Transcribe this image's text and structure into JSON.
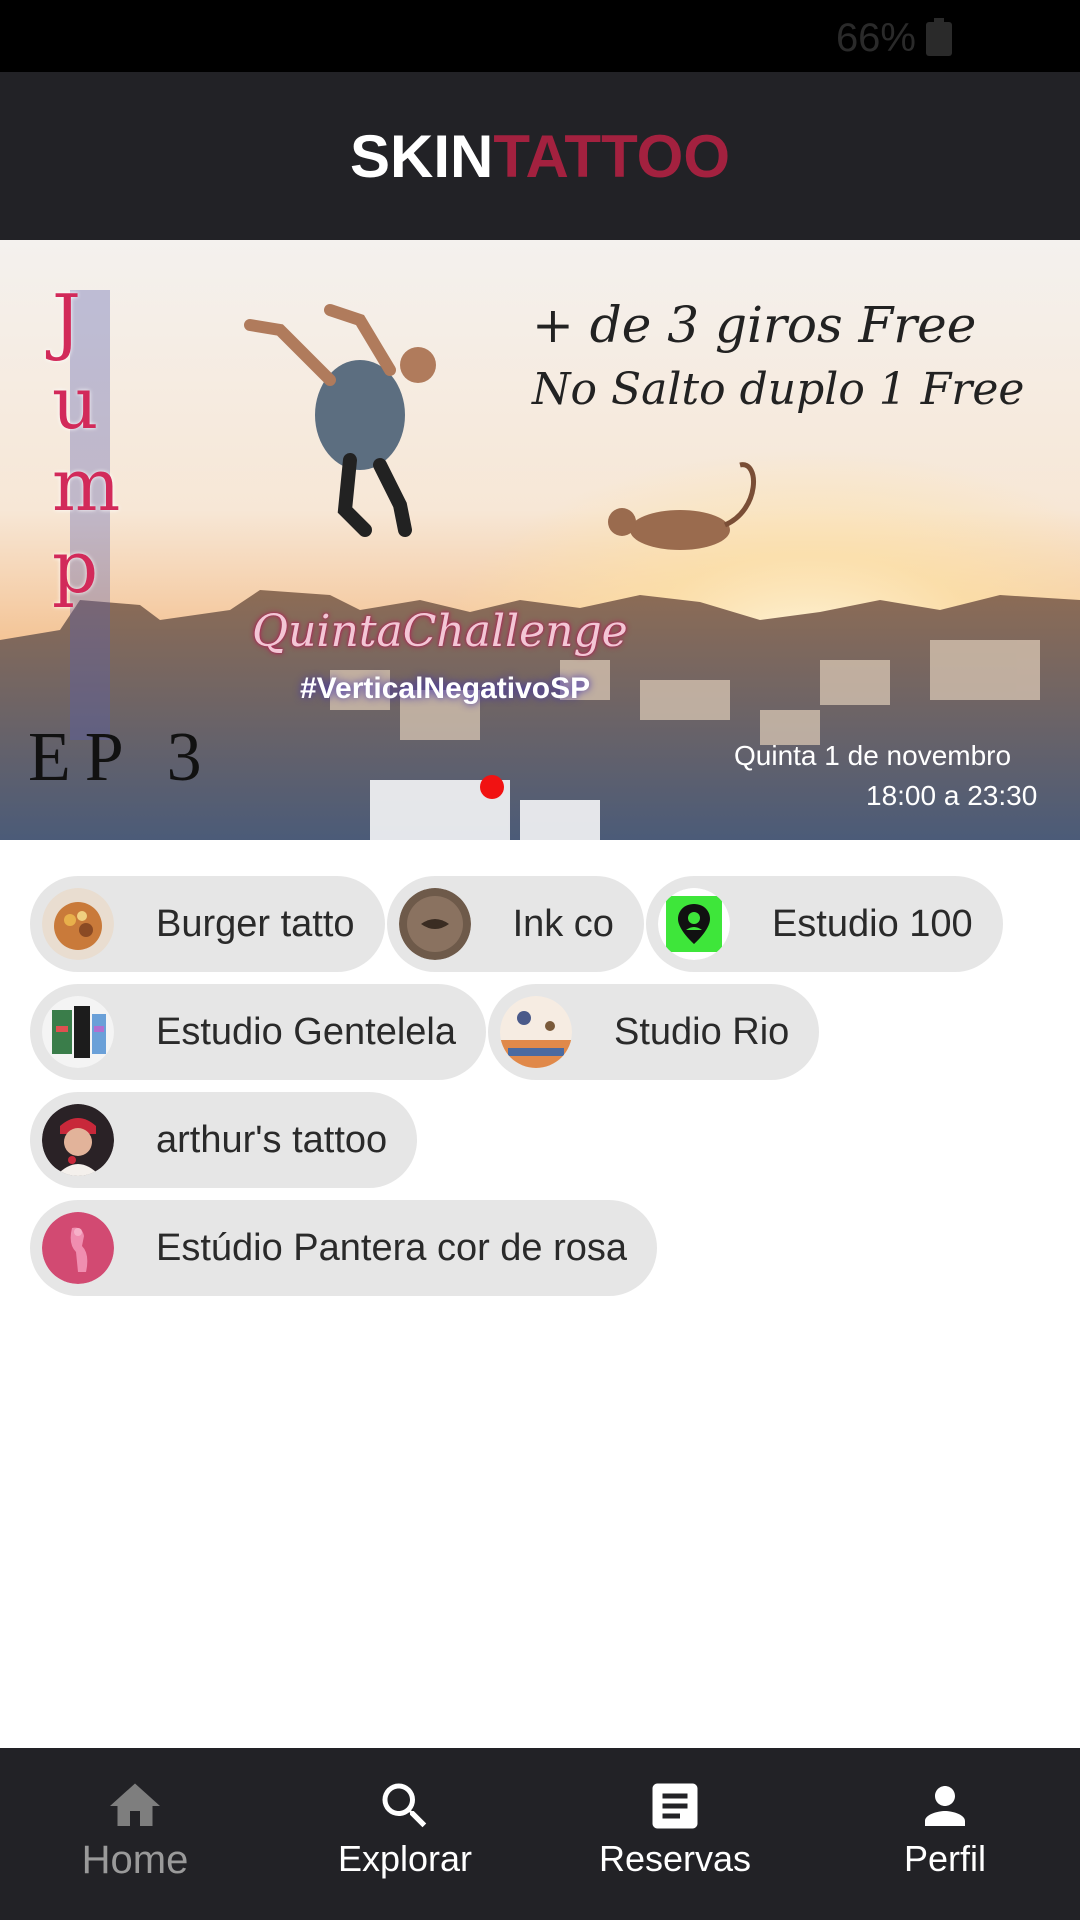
{
  "status_bar": {
    "battery_percent": "66%",
    "battery_icon": "battery-icon"
  },
  "header": {
    "title_part1": "SKIN",
    "title_part2": "TATTOO",
    "title_colors": [
      "#ffffff",
      "#a3213f"
    ]
  },
  "banner": {
    "jump_text": "Jump",
    "ep_text": "EP 3",
    "line1": "+ de 3 giros Free",
    "line2": "No Salto duplo 1 Free",
    "challenge": "QuintaChallenge",
    "hashtag": "#VerticalNegativoSP",
    "date": "Quinta 1 de novembro",
    "time": "18:00 a 23:30",
    "page_indicator_active": 1,
    "indicator_color": "#f11212"
  },
  "studios": [
    {
      "name": "Burger tatto",
      "avatar": "burger-avatar"
    },
    {
      "name": "Ink co",
      "avatar": "ink-avatar"
    },
    {
      "name": "Estudio 100",
      "avatar": "location-pin-avatar"
    },
    {
      "name": "Estudio Gentelela",
      "avatar": "gentelela-avatar"
    },
    {
      "name": "Studio Rio",
      "avatar": "rio-avatar"
    },
    {
      "name": "arthur's tattoo",
      "avatar": "arthur-avatar"
    },
    {
      "name": "Estúdio Pantera cor de rosa",
      "avatar": "pantera-avatar"
    }
  ],
  "bottom_nav": [
    {
      "label": "Home",
      "icon": "home-icon",
      "active": true
    },
    {
      "label": "Explorar",
      "icon": "search-icon",
      "active": false
    },
    {
      "label": "Reservas",
      "icon": "document-icon",
      "active": false
    },
    {
      "label": "Perfil",
      "icon": "person-icon",
      "active": false
    }
  ],
  "colors": {
    "header_bg": "#222226",
    "chip_bg": "#e6e6e6",
    "accent": "#a3213f"
  }
}
